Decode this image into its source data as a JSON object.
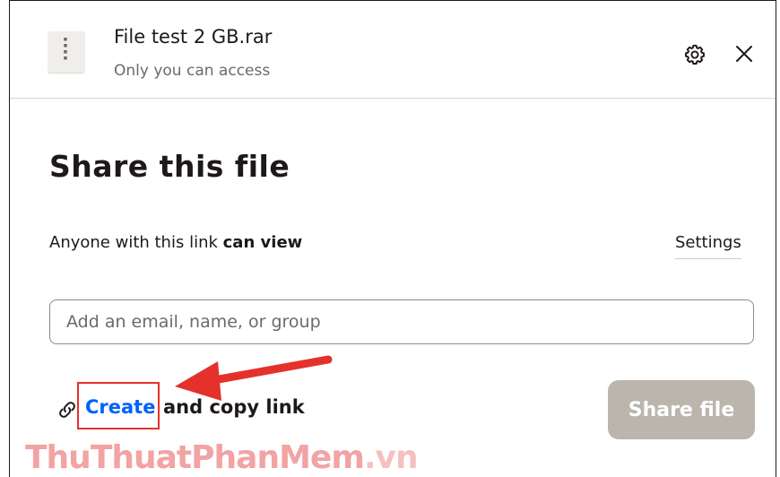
{
  "header": {
    "file_name": "File test 2 GB.rar",
    "access": "Only you can access",
    "icons": {
      "file": "zip-file-icon",
      "settings": "gear-icon",
      "close": "close-icon"
    }
  },
  "share": {
    "title": "Share this file",
    "permission_prefix": "Anyone with this link",
    "permission_value": "can view",
    "settings_label": "Settings",
    "email_placeholder": "Add an email, name, or group",
    "create_label": "Create",
    "copy_suffix": "and copy link",
    "share_button": "Share file"
  },
  "watermark": {
    "part1": "ThuThuat",
    "part2": "PhanMem",
    "part3": ".vn"
  },
  "colors": {
    "link_blue": "#0061fe",
    "highlight_red": "#e5312c",
    "disabled_button": "#bbb5ae"
  }
}
